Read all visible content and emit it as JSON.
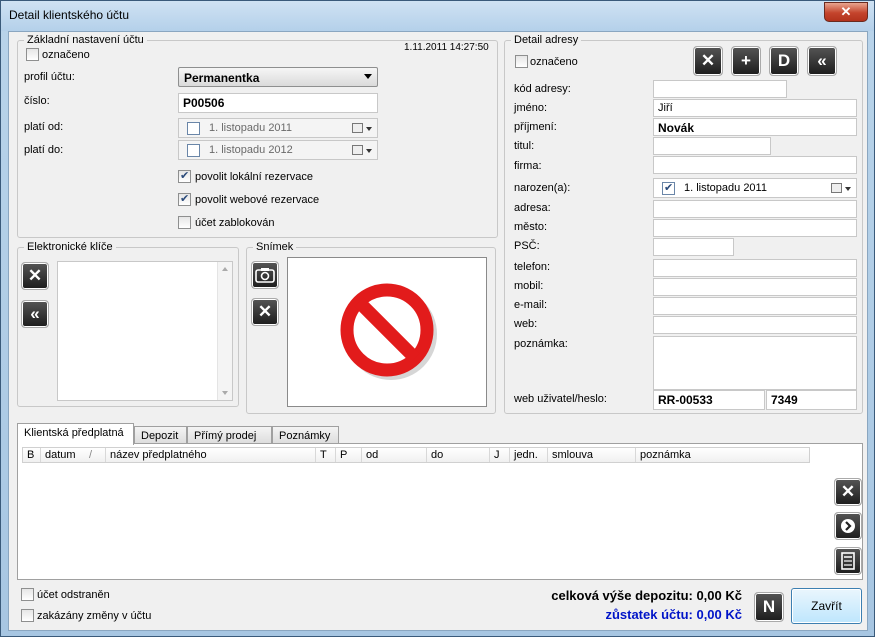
{
  "window": {
    "title": "Detail klientského účtu",
    "close_glyph": "✕"
  },
  "account": {
    "group_title": "Základní nastavení účtu",
    "marked_label": "označeno",
    "timestamp": "1.11.2011 14:27:50",
    "profile_label": "profil účtu:",
    "profile_value": "Permanentka",
    "number_label": "číslo:",
    "number_value": "P00506",
    "valid_from_label": "platí od:",
    "valid_from_value": "1. listopadu  2011",
    "valid_to_label": "platí do:",
    "valid_to_value": "1. listopadu  2012",
    "local_res_label": "povolit lokální rezervace",
    "web_res_label": "povolit webové rezervace",
    "blocked_label": "účet zablokován"
  },
  "keys": {
    "group_title": "Elektronické klíče"
  },
  "photo": {
    "group_title": "Snímek"
  },
  "address": {
    "group_title": "Detail adresy",
    "marked_label": "označeno",
    "btn_add": "+",
    "btn_d": "D",
    "code_label": "kód adresy:",
    "code_value": "",
    "name_label": "jméno:",
    "name_value": "Jiří",
    "surname_label": "příjmení:",
    "surname_value": "Novák",
    "title_label": "titul:",
    "company_label": "firma:",
    "born_label": "narozen(a):",
    "born_value": "1. listopadu  2011",
    "addr_label": "adresa:",
    "city_label": "město:",
    "zip_label": "PSČ:",
    "phone_label": "telefon:",
    "mobile_label": "mobil:",
    "email_label": "e-mail:",
    "web_label": "web:",
    "note_label": "poznámka:",
    "webuser_label": "web uživatel/heslo:",
    "webuser_value": "RR-00533",
    "webpass_value": "7349"
  },
  "tabs": [
    "Klientská předplatná",
    "Depozit",
    "Přímý prodej",
    "Poznámky"
  ],
  "grid_columns": [
    "B",
    "datum",
    "/",
    "název předplatného",
    "T",
    "P",
    "od",
    "do",
    "J",
    "jedn.",
    "smlouva",
    "poznámka"
  ],
  "footer": {
    "deleted_label": "účet odstraněn",
    "locked_label": "zakázány změny v účtu",
    "deposit_total": "celková výše depozitu: 0,00 Kč",
    "balance": "zůstatek účtu: 0,00 Kč",
    "n_button": "N",
    "close_button": "Zavřít"
  }
}
